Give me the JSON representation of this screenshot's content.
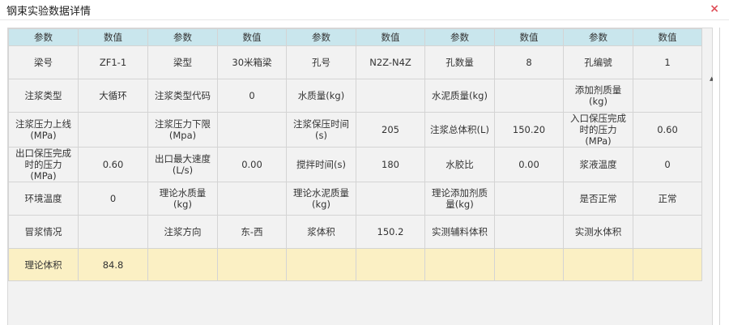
{
  "window": {
    "title": "钢束实验数据详情",
    "close_symbol": "×"
  },
  "table": {
    "headers": [
      "参数",
      "数值",
      "参数",
      "数值",
      "参数",
      "数值",
      "参数",
      "数值",
      "参数",
      "数值"
    ],
    "rows": [
      [
        "梁号",
        "ZF1-1",
        "梁型",
        "30米箱梁",
        "孔号",
        "N2Z-N4Z",
        "孔数量",
        "8",
        "孔编號",
        "1"
      ],
      [
        "注浆类型",
        "大循环",
        "注浆类型代码",
        "0",
        "水质量(kg)",
        "",
        "水泥质量(kg)",
        "",
        "添加剂质量(kg)",
        ""
      ],
      [
        "注浆压力上线(MPa)",
        "",
        "注浆压力下限(Mpa)",
        "",
        "注浆保压时间(s)",
        "205",
        "注浆总体积(L)",
        "150.20",
        "入口保压完成时的压力(MPa)",
        "0.60"
      ],
      [
        "出口保压完成时的压力(MPa)",
        "0.60",
        "出口最大速度(L/s)",
        "0.00",
        "搅拌时间(s)",
        "180",
        "水胶比",
        "0.00",
        "浆液温度",
        "0"
      ],
      [
        "环境温度",
        "0",
        "理论水质量(kg)",
        "",
        "理论水泥质量(kg)",
        "",
        "理论添加剂质量(kg)",
        "",
        "是否正常",
        "正常"
      ],
      [
        "冒浆情况",
        "",
        "注浆方向",
        "东-西",
        "浆体积",
        "150.2",
        "实测辅料体积",
        "",
        "实测水体积",
        ""
      ],
      [
        "理论体积",
        "84.8",
        "",
        "",
        "",
        "",
        "",
        "",
        "",
        ""
      ]
    ]
  },
  "colors": {
    "header_bg": "#c9e6ed",
    "highlight_row_bg": "#fbf0c4",
    "body_bg": "#f2f2f2",
    "close_icon": "#e0505a"
  },
  "icons": {
    "close": "close-icon",
    "scroll_up": "scroll-up-icon"
  }
}
